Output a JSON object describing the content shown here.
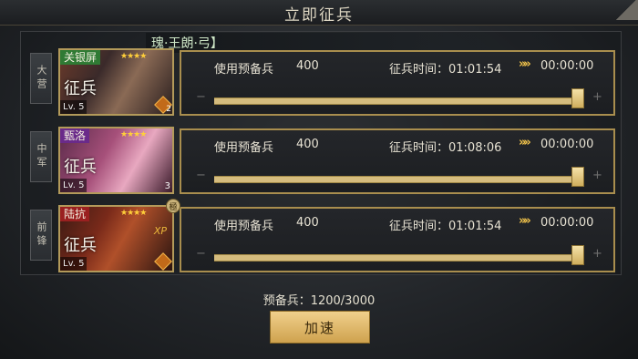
{
  "title": "立即征兵",
  "banner": "瑰·王朗·弓】",
  "rows": [
    {
      "tab": "大营",
      "general": "关银屏",
      "stars": "★★★★",
      "status": "征兵",
      "level": "Lv. 5",
      "badge": "2",
      "reserve_label": "使用预备兵",
      "reserve_value": "400",
      "time_label": "征兵时间：01:01:54",
      "arrows": "»»",
      "remaining": "00:00:00",
      "slider_fraction": 1.0
    },
    {
      "tab": "中军",
      "general": "甄洛",
      "stars": "★★★★",
      "status": "征兵",
      "level": "Lv. 5",
      "badge": "3",
      "reserve_label": "使用预备兵",
      "reserve_value": "400",
      "time_label": "征兵时间：01:08:06",
      "arrows": "»»",
      "remaining": "00:00:00",
      "slider_fraction": 1.0
    },
    {
      "tab": "前锋",
      "general": "陆抗",
      "stars": "★★★★",
      "status": "征兵",
      "level": "Lv. 5",
      "badge": "",
      "xp": "XP",
      "reserve_label": "使用预备兵",
      "reserve_value": "400",
      "time_label": "征兵时间：01:01:54",
      "arrows": "»»",
      "remaining": "00:00:00",
      "slider_fraction": 1.0
    }
  ],
  "ji_marks": [
    "極"
  ],
  "footer": {
    "reserve_text": "预备兵：1200/3000",
    "speed_button": "加速"
  },
  "colors": {
    "accent_gold": "#d5bc7e",
    "star": "#ffcf3a",
    "arrows": "#f0c24a"
  }
}
